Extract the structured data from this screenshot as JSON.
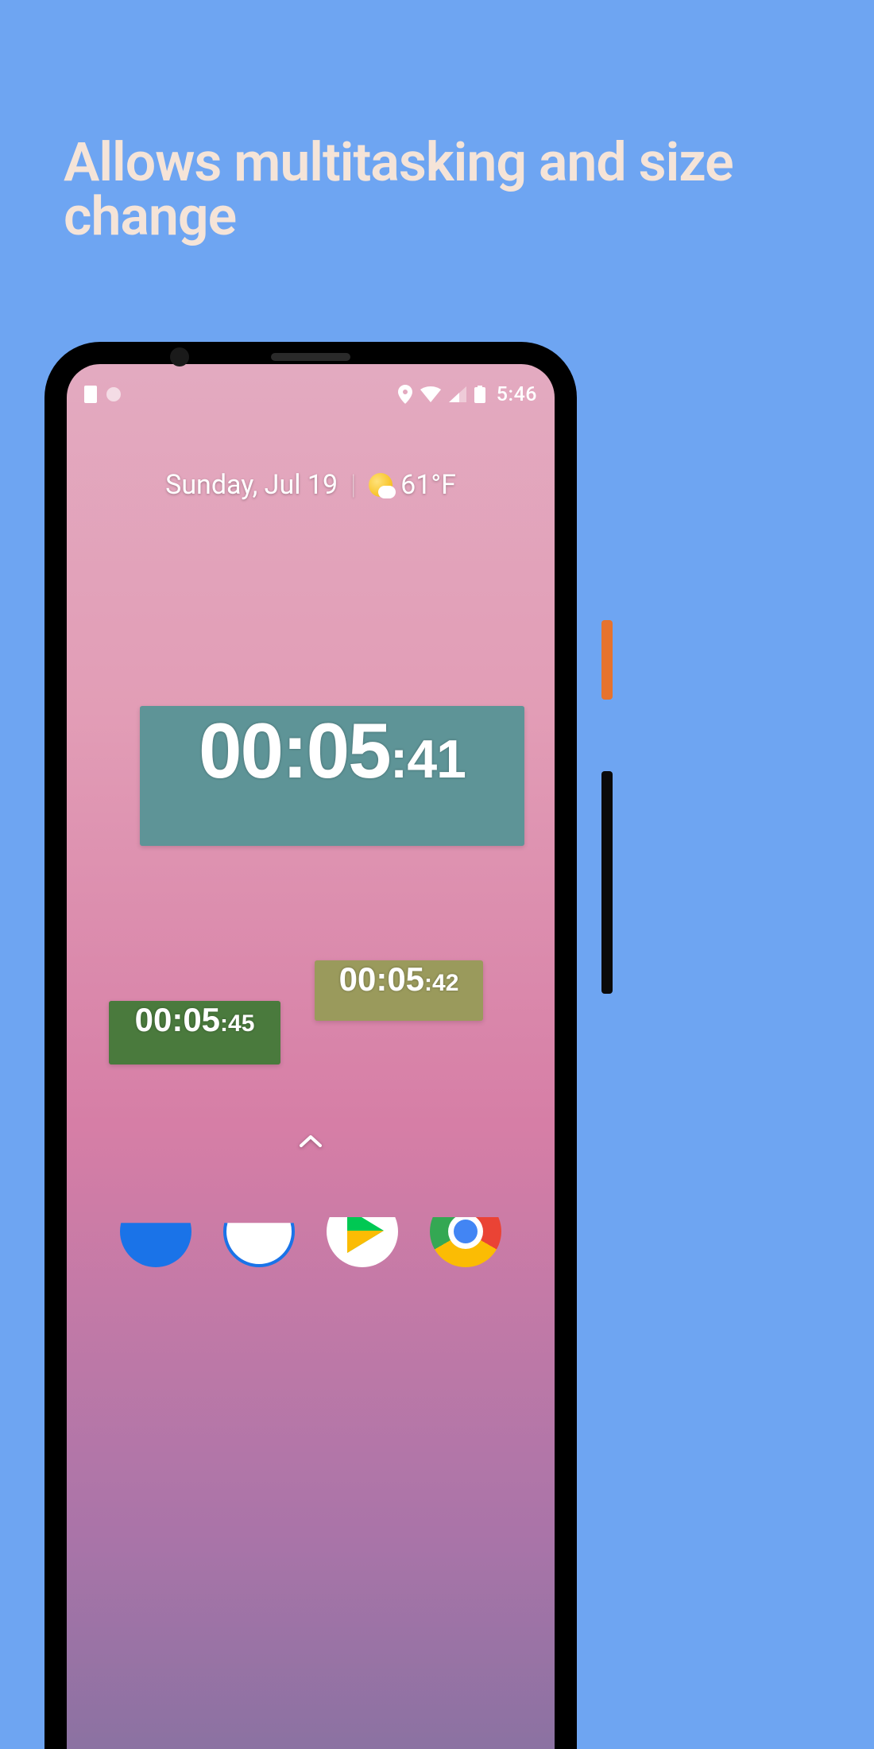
{
  "headline": "Allows multitasking and size change",
  "status_bar": {
    "time": "5:46"
  },
  "home": {
    "date": "Sunday, Jul 19",
    "temperature": "61°F"
  },
  "widgets": {
    "large": {
      "main": "00:05",
      "sub": ":41",
      "color": "#5e9497"
    },
    "medium": {
      "main": "00:05",
      "sub": ":42",
      "color": "#9a9a5c"
    },
    "small": {
      "main": "00:05",
      "sub": ":45",
      "color": "#4a7a3d"
    }
  }
}
